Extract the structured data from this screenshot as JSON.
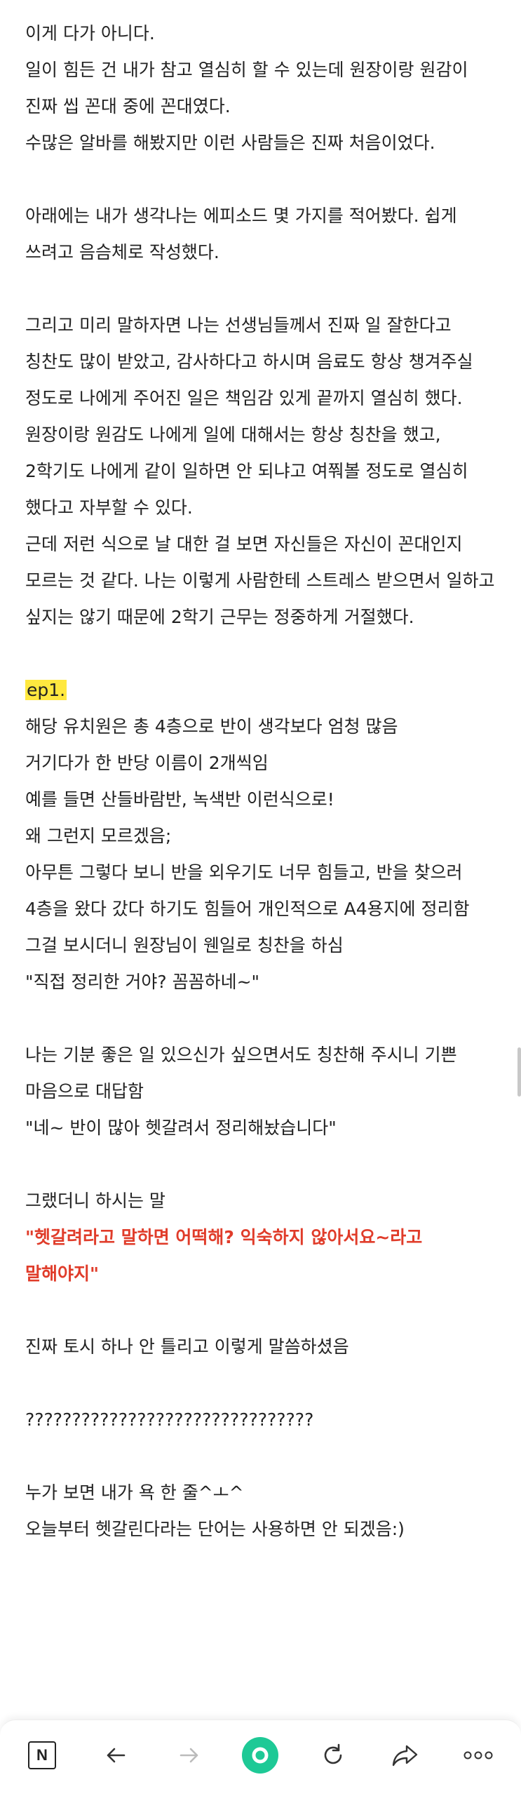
{
  "paragraphs": [
    "이게 다가 아니다.\n일이 힘든 건 내가 참고 열심히 할 수 있는데 원장이랑 원감이 진짜 씹 꼰대 중에 꼰대였다.\n수많은 알바를 해봤지만 이런 사람들은 진짜 처음이었다.",
    "아래에는 내가 생각나는 에피소드 몇 가지를 적어봤다. 쉽게 쓰려고 음슴체로 작성했다.",
    "그리고 미리 말하자면 나는 선생님들께서 진짜 일 잘한다고 칭찬도 많이 받았고, 감사하다고 하시며 음료도 항상 챙겨주실 정도로 나에게 주어진 일은 책임감 있게 끝까지 열심히 했다.\n원장이랑 원감도 나에게 일에 대해서는 항상 칭찬을 했고, 2학기도 나에게 같이 일하면 안 되냐고 여쭤볼 정도로 열심히 했다고 자부할 수 있다.\n근데 저런 식으로 날 대한 걸 보면 자신들은 자신이 꼰대인지 모르는 것 같다. 나는 이렇게 사람한테 스트레스 받으면서 일하고 싶지는 않기 때문에 2학기 근무는 정중하게 거절했다."
  ],
  "episode": {
    "label": "ep1.",
    "lines": [
      "해당 유치원은 총 4층으로 반이 생각보다 엄청 많음\n거기다가 한 반당 이름이 2개씩임\n예를 들면 산들바람반, 녹색반 이런식으로!\n왜 그런지 모르겠음;\n아무튼 그렇다 보니 반을 외우기도 너무 힘들고, 반을 찾으러 4층을 왔다 갔다 하기도 힘들어 개인적으로 A4용지에 정리함\n그걸 보시더니 원장님이 웬일로 칭찬을 하심\n\"직접 정리한 거야? 꼼꼼하네~\"",
      "나는 기분 좋은 일 있으신가 싶으면서도 칭찬해 주시니 기쁜 마음으로 대답함\n\"네~ 반이 많아 헷갈려서 정리해놨습니다\"",
      "그랬더니 하시는 말"
    ],
    "quote": "\"헷갈려라고 말하면 어떡해? 익숙하지 않아서요~라고 말해야지\"",
    "after": [
      "진짜 토시 하나 안 틀리고 이렇게 말씀하셨음",
      "???????????????????????????????",
      "누가 보면 내가 욕 한 줄^ㅗ^\n오늘부터 헷갈린다라는 단어는 사용하면 안 되겠음:)"
    ]
  },
  "bottom_bar": {
    "home_logo": "N",
    "icons": [
      "naver-logo-icon",
      "back-arrow-icon",
      "forward-arrow-icon",
      "green-dot-icon",
      "refresh-icon",
      "share-icon",
      "more-icon"
    ],
    "accent_color": "#1ec996"
  }
}
